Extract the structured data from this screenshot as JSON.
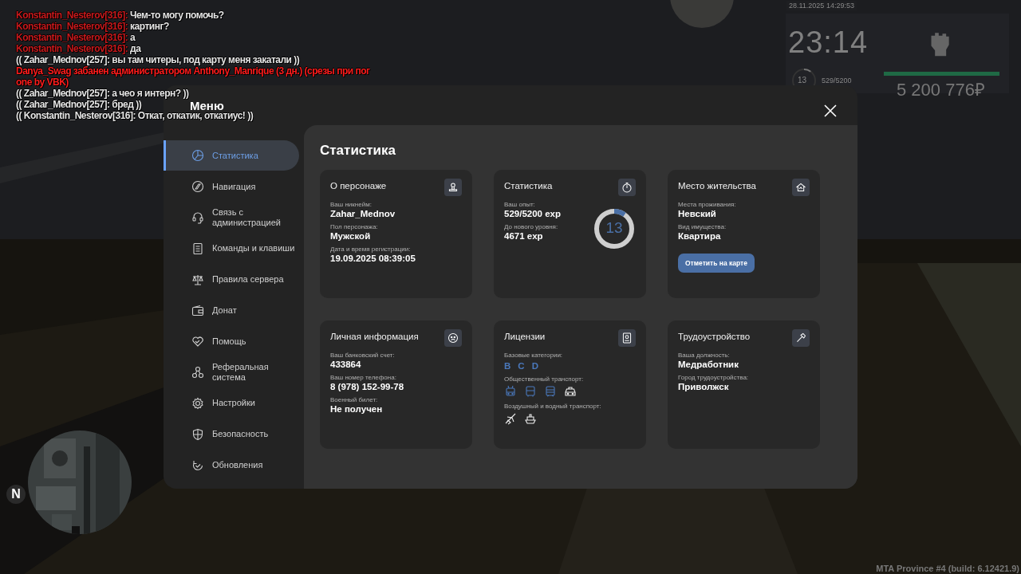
{
  "chat": [
    {
      "kind": "player",
      "name": "Konstantin_Nesterov[316]:",
      "text": "Чем-то могу помочь?"
    },
    {
      "kind": "player",
      "name": "Konstantin_Nesterov[316]:",
      "text": "картинг?"
    },
    {
      "kind": "player",
      "name": "Konstantin_Nesterov[316]:",
      "text": "а"
    },
    {
      "kind": "player",
      "name": "Konstantin_Nesterov[316]:",
      "text": "да"
    },
    {
      "kind": "ooc",
      "text": "(( Zahar_Mednov[257]: вы там читеры, под карту меня закатали ))"
    },
    {
      "kind": "system",
      "text": "Danya_Swag забанен администратором Anthony_Manrique (3 дн.) (срезы при пог\none by VBK)"
    },
    {
      "kind": "ooc",
      "text": "(( Zahar_Mednov[257]: а чео я интерн? ))"
    },
    {
      "kind": "ooc",
      "text": "(( Zahar_Mednov[257]: бред ))"
    },
    {
      "kind": "ooc",
      "text": "(( Konstantin_Nesterov[316]: Откат, откатик, откатиус! ))"
    }
  ],
  "hud": {
    "datetime": "28.11.2025 14:29:53",
    "clock": "23:14",
    "level": "13",
    "level_ring": {
      "level": 0.1
    },
    "exp": "529/5200",
    "health": {
      "level": 1
    },
    "money": "5 200 776₽"
  },
  "minimap": {
    "north": "N"
  },
  "menu": {
    "title": "Меню",
    "sidebar": [
      {
        "label": "Статистика",
        "selected": true
      },
      {
        "label": "Навигация",
        "selected": false
      },
      {
        "label": "Связь с\nадминистрацией",
        "selected": false
      },
      {
        "label": "Команды и клавиши",
        "selected": false
      },
      {
        "label": "Правила сервера",
        "selected": false
      },
      {
        "label": "Донат",
        "selected": false
      },
      {
        "label": "Помощь",
        "selected": false
      },
      {
        "label": "Реферальная\nсистема",
        "selected": false
      },
      {
        "label": "Настройки",
        "selected": false
      },
      {
        "label": "Безопасность",
        "selected": false
      },
      {
        "label": "Обновления",
        "selected": false
      }
    ],
    "section_title": "Статистика",
    "cards": [
      {
        "kind": "fields",
        "title": "О персонаже",
        "fields": [
          {
            "label": "Ваш никнейм:",
            "value": "Zahar_Mednov"
          },
          {
            "label": "Пол персонажа:",
            "value": "Мужской"
          },
          {
            "label": "Дата и время регистрации:",
            "value": "19.09.2025 08:39:05"
          }
        ]
      },
      {
        "kind": "stats",
        "title": "Статистика",
        "fields": [
          {
            "label": "Ваш опыт:",
            "value": "529/5200 exp"
          },
          {
            "label": "До нового уровня:",
            "value": "4671 exp"
          }
        ],
        "ring": {
          "value": "13",
          "level": 0.1
        }
      },
      {
        "kind": "fields",
        "title": "Место жительства",
        "fields": [
          {
            "label": "Места проживания:",
            "value": "Невский"
          },
          {
            "label": "Вид имущества:",
            "value": "Квартира"
          }
        ],
        "button": "Отметить на карте"
      },
      {
        "kind": "fields",
        "title": "Личная информация",
        "fields": [
          {
            "label": "Ваш банковский счет:",
            "value": "433864"
          },
          {
            "label": "Ваш номер телефона:",
            "value": "8 (978) 152-99-78"
          },
          {
            "label": "Военный билет:",
            "value": "Не получен"
          }
        ]
      },
      {
        "kind": "licenses",
        "title": "Лицензии",
        "groups": [
          {
            "label": "Базовые категории:",
            "kind": "letters",
            "items": [
              {
                "text": "B",
                "held": true
              },
              {
                "text": "C",
                "held": true
              },
              {
                "text": "D",
                "held": true
              }
            ]
          },
          {
            "label": "Общественный транспорт:",
            "kind": "icons",
            "items": [
              {
                "held": true
              },
              {
                "held": true
              },
              {
                "held": true
              },
              {
                "held": false
              }
            ]
          },
          {
            "label": "Воздушный и водный транспорт:",
            "kind": "icons",
            "items": [
              {
                "held": false
              },
              {
                "held": false
              }
            ]
          }
        ]
      },
      {
        "kind": "fields",
        "title": "Трудоустройство",
        "fields": [
          {
            "label": "Ваша должность:",
            "value": "Медработник"
          },
          {
            "label": "Город трудоустройства:",
            "value": "Приволжск"
          }
        ]
      }
    ]
  },
  "build": "MTA Province #4 (build: 6.12421.9)"
}
